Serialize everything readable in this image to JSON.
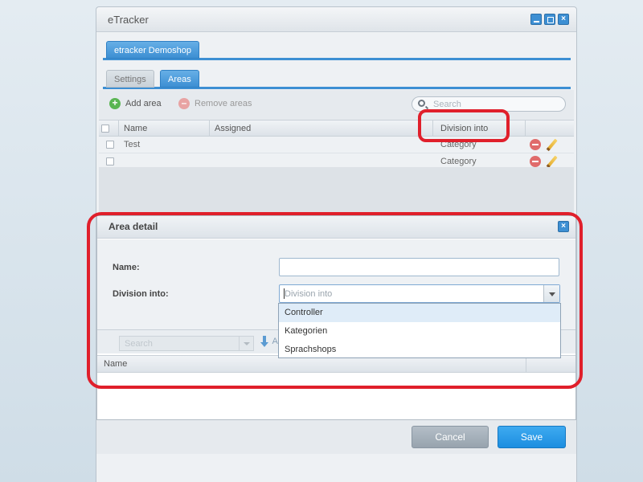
{
  "window": {
    "title": "eTracker"
  },
  "tabs_top": [
    {
      "label": "etracker Demoshop"
    }
  ],
  "tabs_second": [
    {
      "label": "Settings"
    },
    {
      "label": "Areas"
    }
  ],
  "toolbar": {
    "add_label": "Add area",
    "remove_label": "Remove areas",
    "search_placeholder": "Search"
  },
  "grid": {
    "columns": [
      "Name",
      "Assigned",
      "Division into"
    ],
    "rows": [
      {
        "name": "Test",
        "assigned": "",
        "division": "Category"
      },
      {
        "name": "",
        "assigned": "",
        "division": "Category"
      }
    ]
  },
  "dialog": {
    "title": "Area detail",
    "name_label": "Name:",
    "name_value": "",
    "division_label": "Division into:",
    "division_placeholder": "Division into",
    "options": [
      "Controller",
      "Kategorien",
      "Sprachshops"
    ],
    "sub_search_placeholder": "Search",
    "sub_add_label": "A",
    "grid_column": "Name"
  },
  "footer": {
    "cancel_label": "Cancel",
    "save_label": "Save"
  },
  "colors": {
    "accent": "#3d8fd3",
    "highlight": "#e01f2b",
    "save": "#1c8ee0"
  }
}
